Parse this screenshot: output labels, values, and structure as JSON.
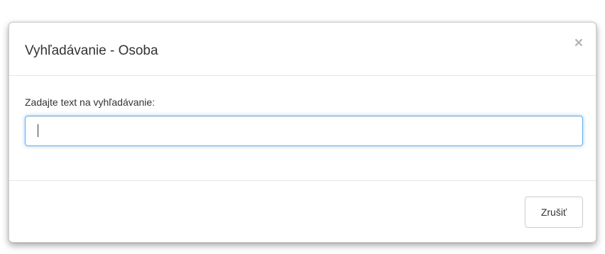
{
  "dialog": {
    "title": "Vyhľadávanie - Osoba",
    "close_label": "×"
  },
  "search": {
    "label": "Zadajte text na vyhľadávanie:",
    "value": "",
    "placeholder": ""
  },
  "footer": {
    "cancel_label": "Zrušiť"
  },
  "colors": {
    "focus_border": "#66afe9",
    "text": "#333333",
    "divider": "#e5e5e5"
  }
}
